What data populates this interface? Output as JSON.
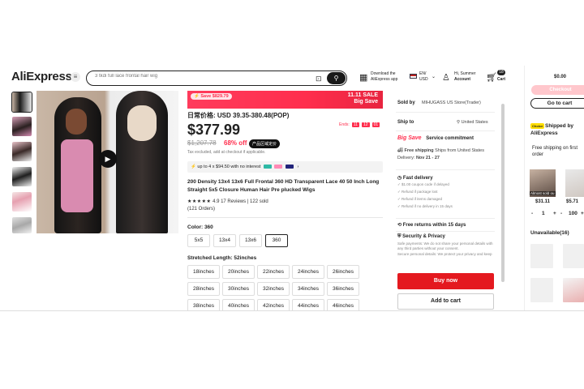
{
  "header": {
    "logo": "AliExpress",
    "search_placeholder": "3 tkdi full lace frontal hair wig",
    "download_label": "Download the AliExpress app",
    "lang_label": "EN/ USD",
    "account_greeting": "Hi, Summer",
    "account_label": "Account",
    "cart_label": "Cart",
    "cart_count": "18"
  },
  "gallery": {
    "thumbnail_count": 6
  },
  "promo": {
    "save_label": "Save $829.79",
    "sale_title_line1": "11.11 SALE",
    "sale_title_line2": "Big Save"
  },
  "pricing": {
    "cn_price": "日常价格: USD 39.35-380.48(POP)",
    "ends_label": "Ends:",
    "ends_h": "11",
    "ends_m": "12",
    "ends_s": "01",
    "price": "$377.99",
    "old_price": "$1,207.78",
    "discount": "68% off",
    "cn_badge": "产品区域定价",
    "tax_note": "Tax excluded, add at checkout if applicable.",
    "installment": "up to 4 x $94.50 with no interest"
  },
  "product": {
    "title": "200 Density 13x4 13x6 Full Frontal 360 HD Transparent Lace 40 50 Inch Long Straight 5x5 Closure Human Hair Pre plucked Wigs",
    "stars": "★★★★★",
    "rating": "4.9",
    "reviews": "17 Reviews",
    "sold": "122 sold",
    "orders": "(121 Orders)"
  },
  "options": {
    "color_label": "Color: 360",
    "colors": [
      "5x5",
      "13x4",
      "13x6",
      "360"
    ],
    "length_label": "Stretched Length: 52inches",
    "lengths": [
      "18inches",
      "20inches",
      "22inches",
      "24inches",
      "26inches",
      "28inches",
      "30inches",
      "32inches",
      "34inches",
      "36inches",
      "38inches",
      "40inches",
      "42inches",
      "44inches",
      "46inches"
    ]
  },
  "side": {
    "sold_by_label": "Sold by",
    "store": "MIHUGASS US Store(Trader)",
    "ship_to_label": "Ship to",
    "ship_to": "United States",
    "service_brand": "Big Save",
    "service_label": "Service commitment",
    "free_shipping": "Free shipping",
    "ships_from": "Ships from United States",
    "delivery_label": "Delivery:",
    "delivery_date": "Nov 21 - 27",
    "fast_delivery": "Fast delivery",
    "fast_items": [
      "$1.00 coupon code if delayed",
      "Refund if package lost",
      "Refund if items damaged",
      "Refund if no delivery in 15 days"
    ],
    "free_returns": "Free returns within 15 days",
    "security_title": "Security & Privacy",
    "security_text1": "Safe payments: We do not share your personal details with any third parties without your consent.",
    "security_text2": "Secure personal details: We protect your privacy and keep your personal details safe and secure.",
    "buy_now": "Buy now",
    "add_to_cart": "Add to cart"
  },
  "cart_panel": {
    "total": "$0.00",
    "checkout": "Checkout",
    "go_to_cart": "Go to cart",
    "choice_tag": "Choice",
    "shipped_by": "Shipped by AliExpress",
    "free_first": "Free shipping on first order",
    "soldout": "Almost sold ou",
    "item1_price": "$31.11",
    "item2_price": "$5.71",
    "qty_minus": "-",
    "qty_value": "1",
    "qty_plus": "+",
    "item2_qty": "100",
    "unavailable": "Unavailable(16)"
  },
  "colors": {
    "accent": "#ff2e4d",
    "buy": "#e4191f",
    "dark": "#191919"
  }
}
